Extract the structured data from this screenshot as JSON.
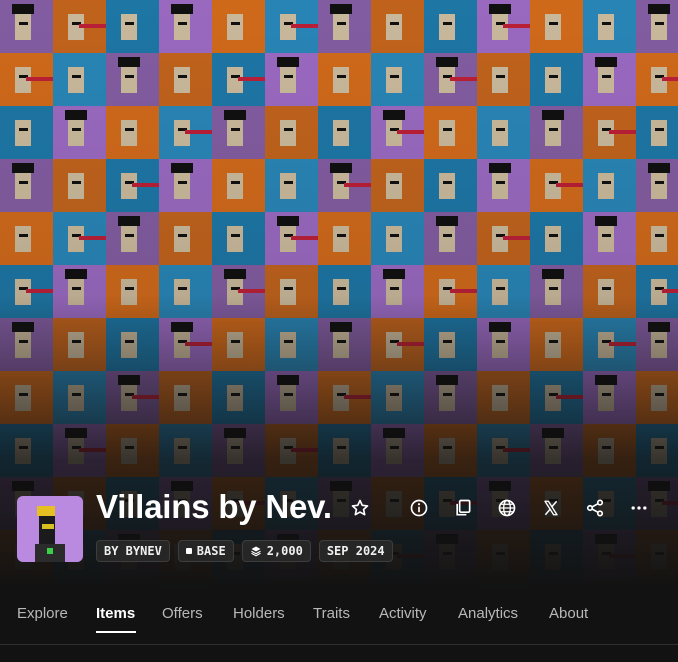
{
  "collection": {
    "name": "Villains by Nev.",
    "avatar_icon": "villain-avatar-icon",
    "badges": [
      {
        "label": "BY BYNEV",
        "icon": null
      },
      {
        "label": "BASE",
        "icon": "chain-square-icon"
      },
      {
        "label": "2,000",
        "icon": "stack-icon"
      },
      {
        "label": "SEP 2024",
        "icon": null
      }
    ]
  },
  "actions": [
    {
      "name": "favorite-button",
      "icon": "star-icon"
    },
    {
      "name": "info-button",
      "icon": "info-icon"
    },
    {
      "name": "copy-button",
      "icon": "copy-icon"
    },
    {
      "name": "website-button",
      "icon": "globe-icon"
    },
    {
      "name": "x-profile-button",
      "icon": "x-logo-icon"
    },
    {
      "name": "share-button",
      "icon": "share-icon"
    },
    {
      "name": "more-button",
      "icon": "more-dots-icon"
    }
  ],
  "tabs": [
    {
      "label": "Explore",
      "active": false
    },
    {
      "label": "Items",
      "active": true
    },
    {
      "label": "Offers",
      "active": false
    },
    {
      "label": "Holders",
      "active": false
    },
    {
      "label": "Traits",
      "active": false
    },
    {
      "label": "Activity",
      "active": false
    },
    {
      "label": "Analytics",
      "active": false
    },
    {
      "label": "About",
      "active": false
    }
  ],
  "colors": {
    "tile_backgrounds": [
      "#8c63ad",
      "#cf6a1e",
      "#1f7fb2",
      "#a571cf",
      "#e0711c",
      "#2b8fc4"
    ],
    "laser_colors": [
      "#2fcc3d",
      "#c8213a",
      "#2fcc3d",
      "#2fcc3d"
    ],
    "page_background": "#121212"
  }
}
